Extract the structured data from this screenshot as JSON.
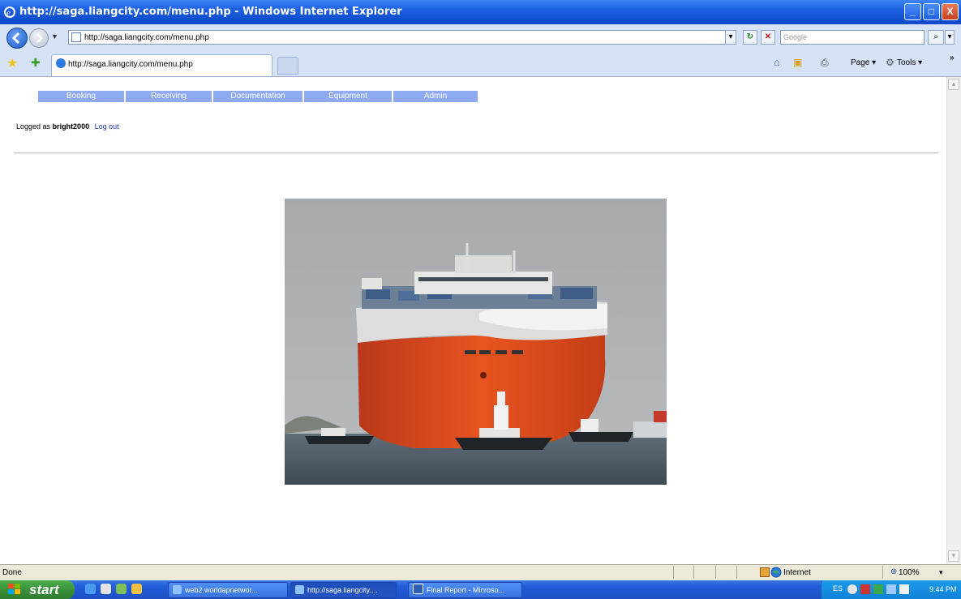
{
  "window": {
    "title": "http://saga.liangcity.com/menu.php - Windows Internet Explorer",
    "controls": {
      "minimize": "_",
      "maximize": "□",
      "close": "X"
    }
  },
  "address_bar": {
    "url": "http://saga.liangcity.com/menu.php",
    "search_placeholder": "Google"
  },
  "tabs": [
    {
      "label": "http://saga.liangcity.com/menu.php",
      "active": true
    }
  ],
  "command_bar": {
    "page_label": "Page",
    "tools_label": "Tools",
    "overflow": "»"
  },
  "page": {
    "menu": [
      "Booking",
      "Receiving",
      "Documentation",
      "Equipment",
      "Admin"
    ],
    "login": {
      "prefix": "Logged as",
      "username": "bright2000",
      "logout_label": "Log out"
    },
    "photo": {
      "subject": "car carrier ship with tugboats"
    }
  },
  "status_bar": {
    "status": "Done",
    "zone": "Internet",
    "zoom": "100%"
  },
  "taskbar": {
    "start_label": "start",
    "tasks": [
      {
        "label": "web2.worldapnetwor...",
        "active": false
      },
      {
        "label": "http://saga.liangcity....",
        "active": true
      },
      {
        "label": "Final Report - Microso...",
        "active": false
      }
    ],
    "clock": "9:44 PM"
  },
  "colors": {
    "menu_bg": "#8eaaf0",
    "titlebar": "#0a48c8",
    "taskbar": "#245edb",
    "start_green": "#3a913a",
    "link": "#1a3fbf"
  }
}
